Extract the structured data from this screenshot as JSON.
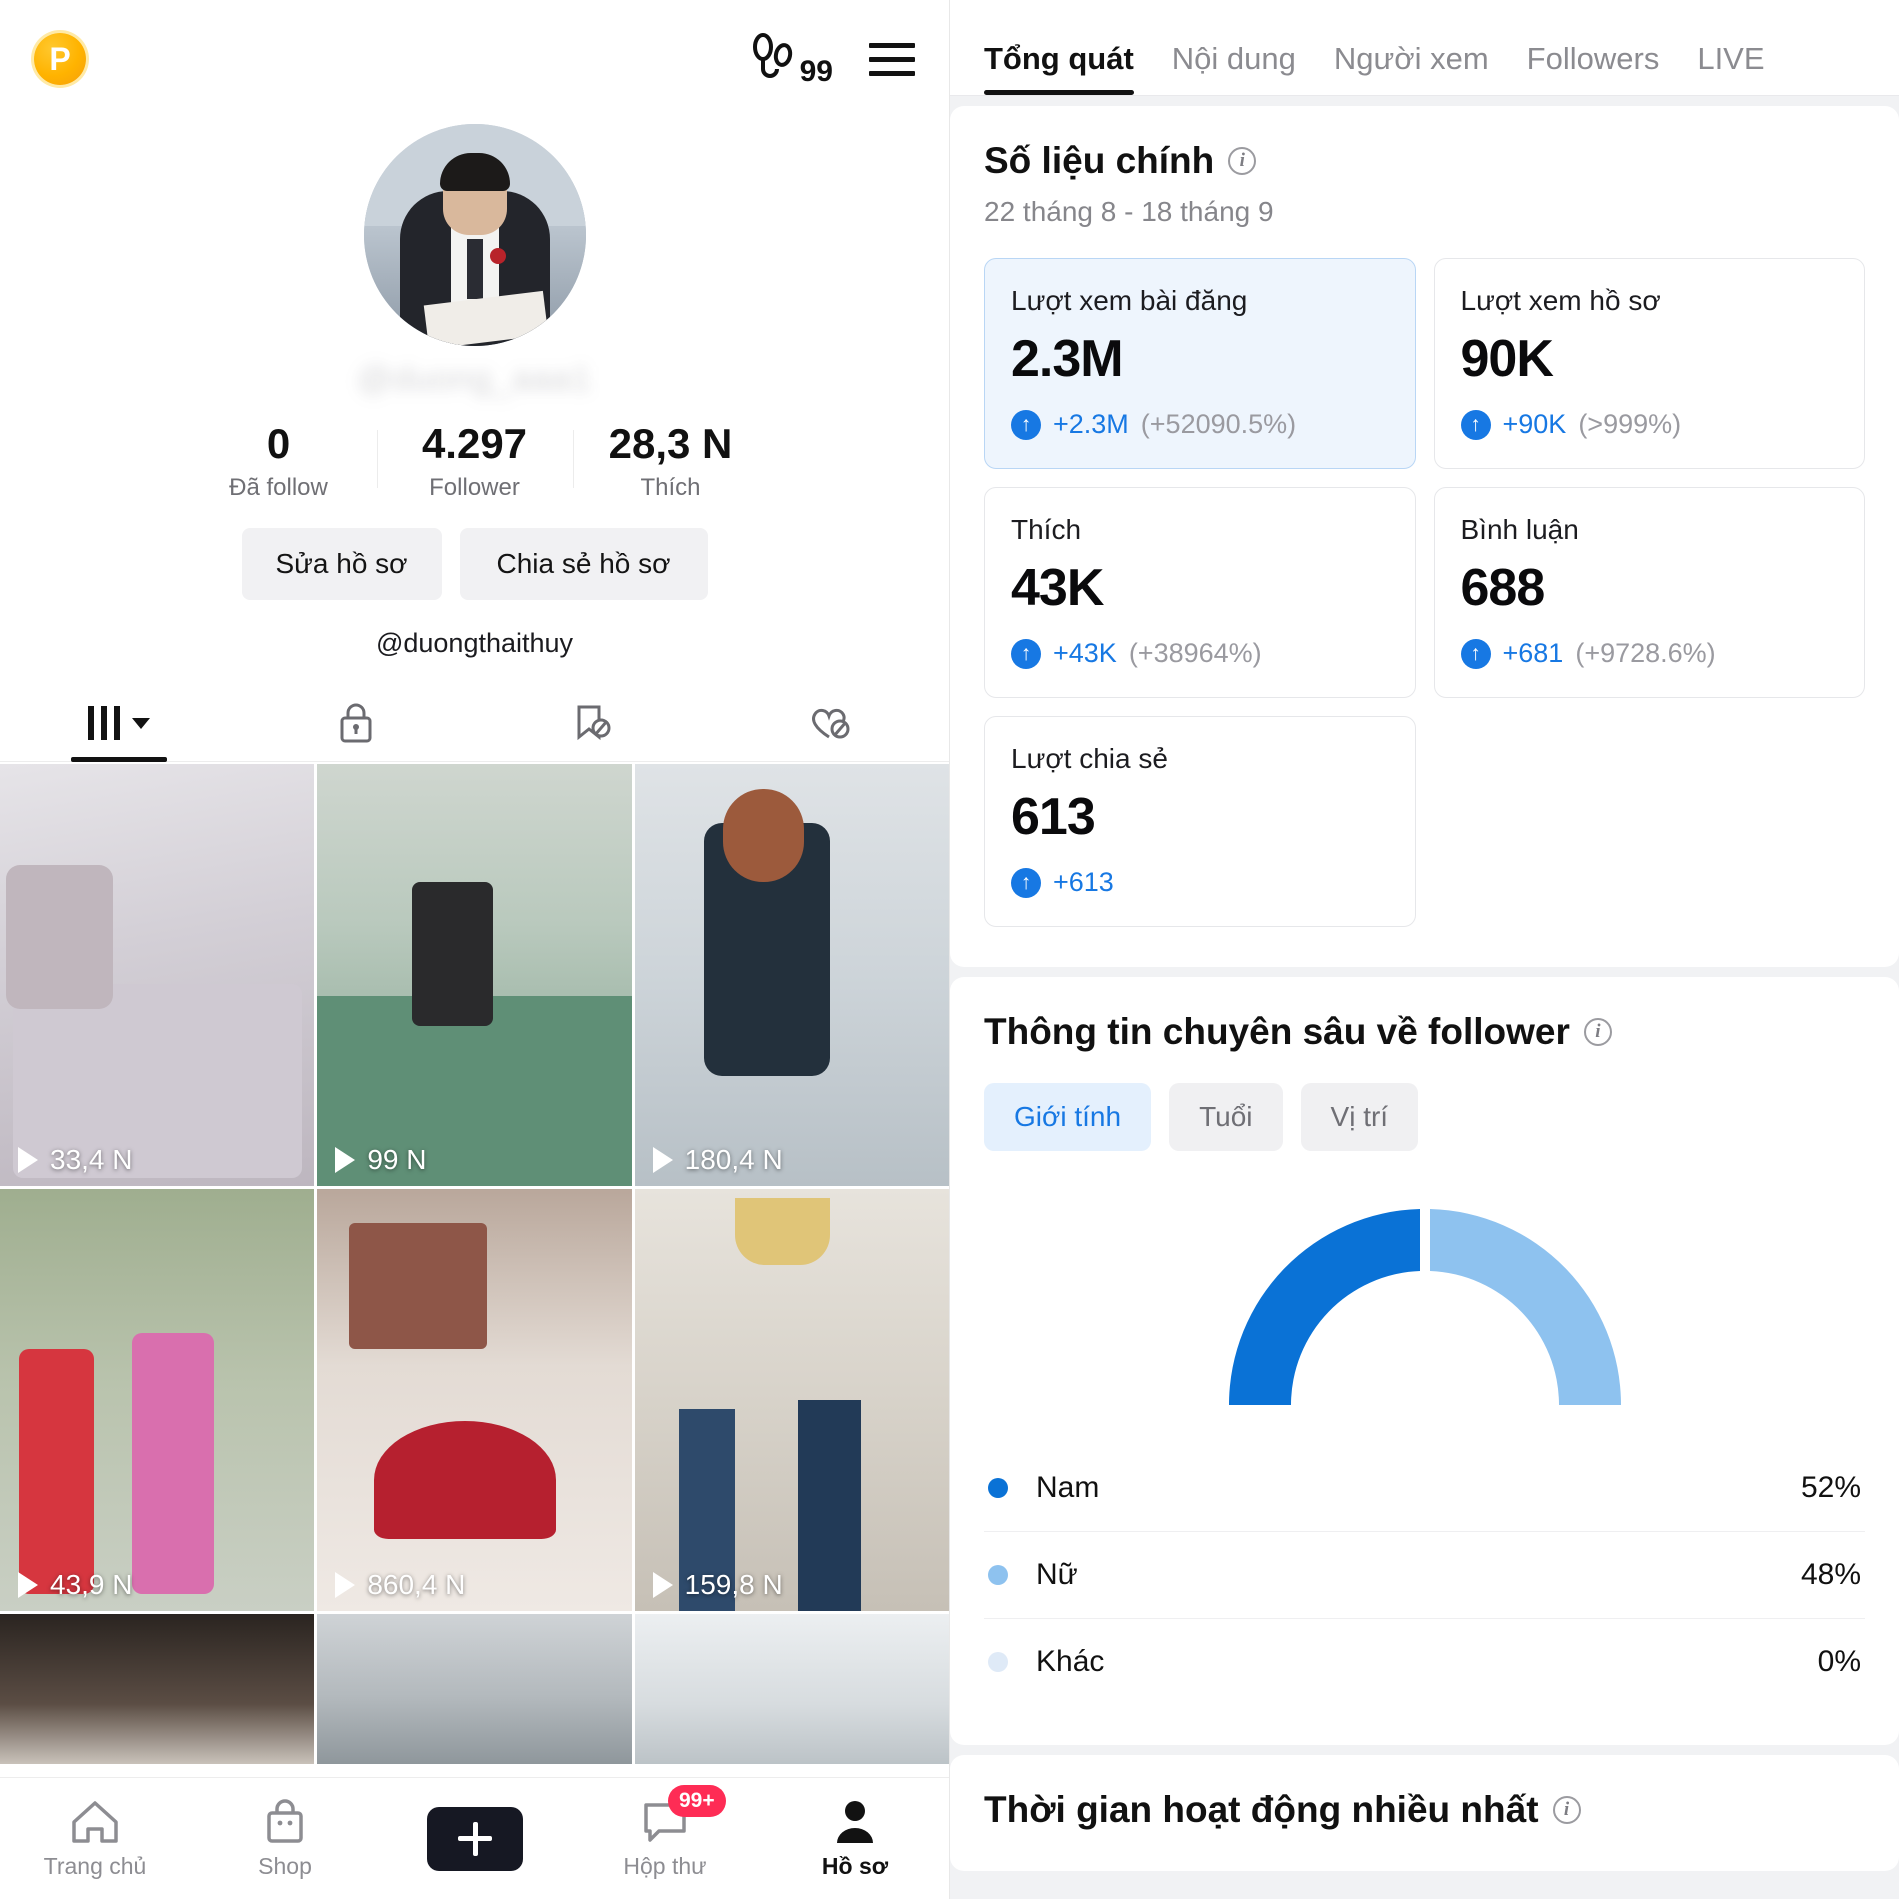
{
  "profile": {
    "badge_letter": "P",
    "visitor_count": "99",
    "handle_blurred": "@duong_aaa1",
    "handle": "@duongthaithuy",
    "stats": [
      {
        "value": "0",
        "label": "Đã follow"
      },
      {
        "value": "4.297",
        "label": "Follower"
      },
      {
        "value": "28,3 N",
        "label": "Thích"
      }
    ],
    "buttons": [
      {
        "label": "Sửa hồ sơ"
      },
      {
        "label": "Chia sẻ hồ sơ"
      }
    ],
    "tabs": [
      {
        "icon": "grid-icon",
        "active": true
      },
      {
        "icon": "lock-icon",
        "active": false
      },
      {
        "icon": "bookmark-hidden-icon",
        "active": false
      },
      {
        "icon": "heart-hidden-icon",
        "active": false
      }
    ],
    "videos": [
      {
        "views": "33,4 N"
      },
      {
        "views": "99 N"
      },
      {
        "views": "180,4 N"
      },
      {
        "views": "43,9 N"
      },
      {
        "views": "860,4 N"
      },
      {
        "views": "159,8 N"
      }
    ]
  },
  "bottom_nav": [
    {
      "label": "Trang chủ",
      "icon": "home-icon",
      "active": false
    },
    {
      "label": "Shop",
      "icon": "shop-bag-icon",
      "active": false
    },
    {
      "label": "",
      "icon": "plus-icon",
      "active": false
    },
    {
      "label": "Hộp thư",
      "icon": "inbox-icon",
      "badge": "99+",
      "active": false
    },
    {
      "label": "Hồ sơ",
      "icon": "person-icon",
      "active": true
    }
  ],
  "analytics": {
    "tabs": [
      {
        "label": "Tổng quát",
        "active": true
      },
      {
        "label": "Nội dung",
        "active": false
      },
      {
        "label": "Người xem",
        "active": false
      },
      {
        "label": "Followers",
        "active": false
      },
      {
        "label": "LIVE",
        "active": false
      }
    ],
    "key_metrics": {
      "title": "Số liệu chính",
      "date_range": "22 tháng 8 - 18 tháng 9",
      "cards": [
        {
          "label": "Lượt xem bài đăng",
          "value": "2.3M",
          "delta": "+2.3M",
          "pct": "(+52090.5%)",
          "highlight": true
        },
        {
          "label": "Lượt xem hồ sơ",
          "value": "90K",
          "delta": "+90K",
          "pct": "(>999%)",
          "highlight": false
        },
        {
          "label": "Thích",
          "value": "43K",
          "delta": "+43K",
          "pct": "(+38964%)",
          "highlight": false
        },
        {
          "label": "Bình luận",
          "value": "688",
          "delta": "+681",
          "pct": "(+9728.6%)",
          "highlight": false
        },
        {
          "label": "Lượt chia sẻ",
          "value": "613",
          "delta": "+613",
          "pct": "",
          "highlight": false
        }
      ]
    },
    "follower_insights": {
      "title": "Thông tin chuyên sâu về follower",
      "pills": [
        {
          "label": "Giới tính",
          "active": true
        },
        {
          "label": "Tuổi",
          "active": false
        },
        {
          "label": "Vị trí",
          "active": false
        }
      ]
    },
    "active_times": {
      "title": "Thời gian hoạt động nhiều nhất"
    }
  },
  "chart_data": {
    "type": "pie",
    "title": "Thông tin chuyên sâu về follower - Giới tính",
    "variant": "half-donut",
    "categories": [
      "Nam",
      "Nữ",
      "Khác"
    ],
    "values": [
      52,
      48,
      0
    ],
    "labels": [
      "52%",
      "48%",
      "0%"
    ],
    "colors": [
      "#0a72d6",
      "#8ec2ef",
      "#dfeaf7"
    ],
    "legend_position": "below",
    "ylim": [
      0,
      100
    ]
  },
  "colors": {
    "accent_blue": "#1778e3",
    "brand_pink": "#fe2c55",
    "brand_cyan": "#25f4ee",
    "badge_orange": "#ffb300"
  }
}
